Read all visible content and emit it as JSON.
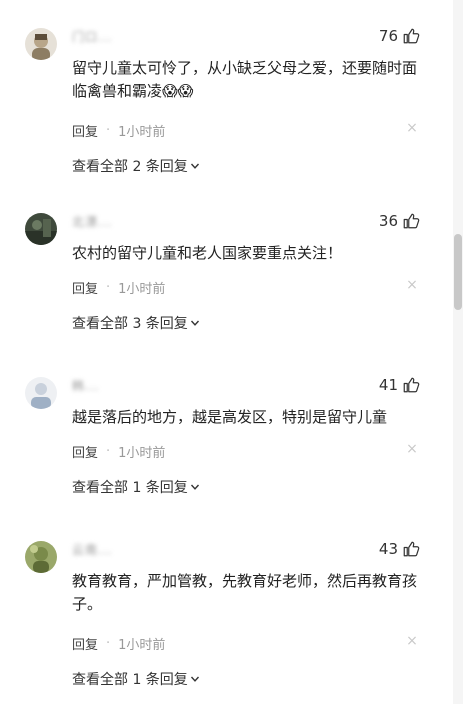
{
  "comments": [
    {
      "username": "门口...",
      "likes": "76",
      "text": "留守儿童太可怜了，从小缺乏父母之爱，还要随时面临禽兽和霸凌😱😱",
      "reply_label": "回复",
      "time": "1小时前",
      "expand_label": "查看全部 2 条回复"
    },
    {
      "username": "北漂...",
      "likes": "36",
      "text": "农村的留守儿童和老人国家要重点关注！",
      "reply_label": "回复",
      "time": "1小时前",
      "expand_label": "查看全部 3 条回复"
    },
    {
      "username": "韩...",
      "likes": "41",
      "text": "越是落后的地方，越是高发区，特别是留守儿童",
      "reply_label": "回复",
      "time": "1小时前",
      "expand_label": "查看全部 1 条回复"
    },
    {
      "username": "云南...",
      "likes": "43",
      "text": "教育教育，严加管教，先教育好老师，然后再教育孩子。",
      "reply_label": "回复",
      "time": "1小时前",
      "expand_label": "查看全部 1 条回复"
    }
  ],
  "colors": {
    "text": "#222222",
    "muted": "#999999",
    "avatar_1": "#b8a68a",
    "avatar_2": "#3f4a3c",
    "avatar_3": "#c9d1dc",
    "avatar_4": "#7a8a4a"
  },
  "icons": {
    "like": "thumb-up-icon",
    "close": "close-icon",
    "expand": "chevron-down-icon"
  }
}
